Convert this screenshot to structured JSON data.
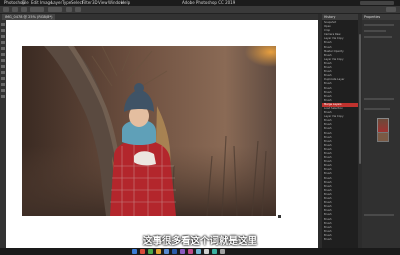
{
  "menubar": {
    "items": [
      "Photoshop",
      "File",
      "Edit",
      "Image",
      "Layer",
      "Type",
      "Select",
      "Filter",
      "3D",
      "View",
      "Window",
      "Help"
    ],
    "app_title": "Adobe Photoshop CC 2019"
  },
  "document": {
    "tab_label": "IMG_0478 @ 25% (RGB/8*)"
  },
  "history": {
    "title": "History",
    "items": [
      "Snapshot",
      "Open",
      "Crop",
      "Camera Raw",
      "Layer Via Copy",
      "Brush",
      "Brush",
      "Master Opacity",
      "Brush",
      "Layer Via Copy",
      "Brush",
      "Brush",
      "Brush",
      "Brush",
      "Duplicate Layer",
      "Brush",
      "Brush",
      "Brush",
      "Brush",
      "Brush",
      "Merge Layers",
      "Load Selection",
      "Brush",
      "Layer Via Copy",
      "Brush",
      "Brush",
      "Brush",
      "Brush",
      "Brush",
      "Brush",
      "Brush",
      "Brush",
      "Brush",
      "Brush",
      "Brush",
      "Brush",
      "Brush",
      "Brush",
      "Brush",
      "Brush",
      "Brush",
      "Brush",
      "Brush",
      "Brush",
      "Brush",
      "Brush",
      "Brush",
      "Brush",
      "Brush",
      "Brush",
      "Brush",
      "Brush",
      "Brush",
      "Brush"
    ],
    "selected_index": 20
  },
  "right_panel": {
    "title": "Properties"
  },
  "subtitle": "这事很多看这个词就是这里"
}
